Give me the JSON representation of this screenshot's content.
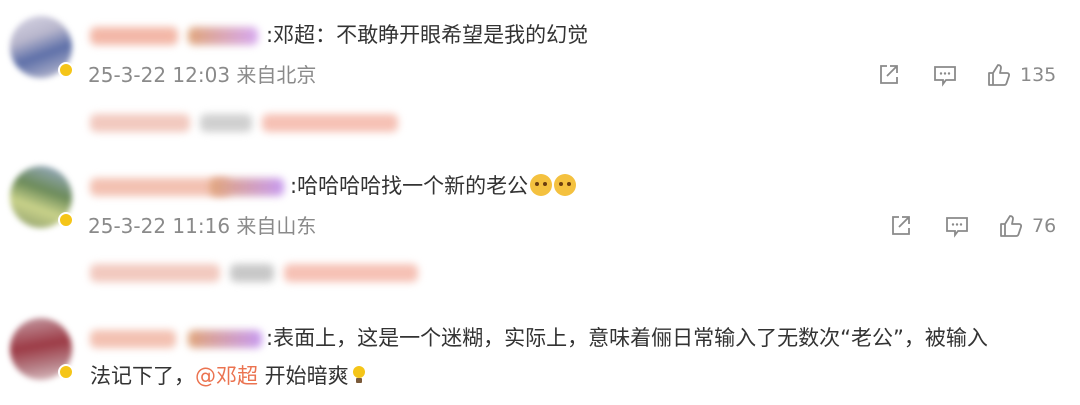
{
  "comments": [
    {
      "text": ":邓超：不敢睁开眼希望是我的幻觉",
      "meta": "25-3-22 12:03 来自北京",
      "like_count": "135"
    },
    {
      "text": ":哈哈哈哈找一个新的老公",
      "meta": "25-3-22 11:16 来自山东",
      "like_count": "76"
    },
    {
      "text_line1": ":表面上，这是一个迷糊，实际上，意味着俪日常输入了无数次“老公”，被输入",
      "text_line2_a": "法记下了，",
      "mention": "@邓超",
      "text_line2_b": " 开始暗爽"
    }
  ],
  "icons": {
    "share": "share-icon",
    "comment": "comment-icon",
    "like": "like-icon",
    "emoji": "doge-emoji-icon",
    "bulb": "lightbulb-emoji-icon"
  },
  "colors": {
    "mention": "#eb7350",
    "meta": "#8a8a8a",
    "verified_badge": "#f5c518"
  }
}
